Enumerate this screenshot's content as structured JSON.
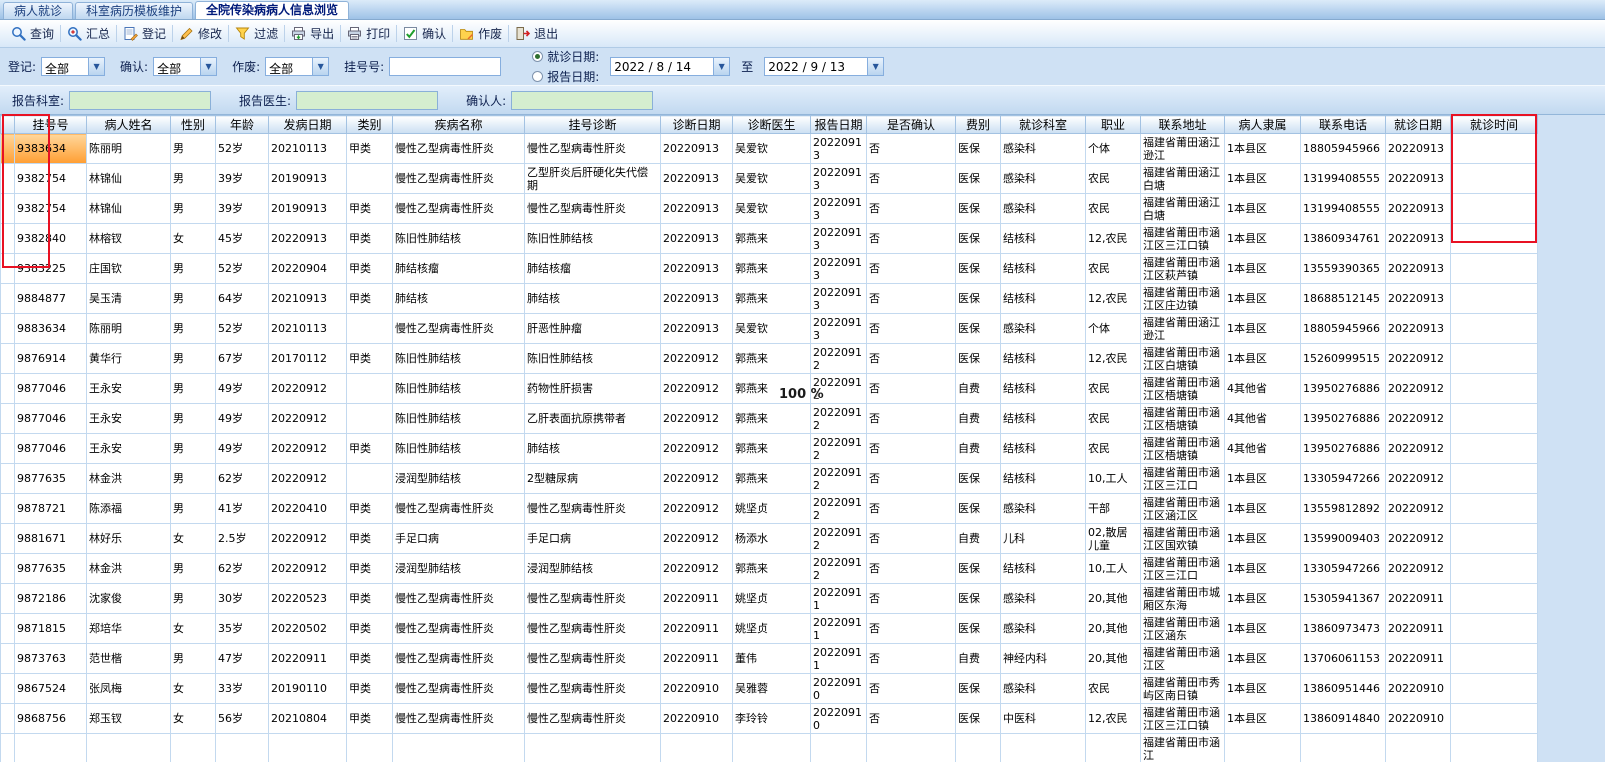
{
  "window": {
    "tabs": [
      {
        "label": "病人就诊",
        "active": false
      },
      {
        "label": "科室病历模板维护",
        "active": false
      },
      {
        "label": "全院传染病病人信息浏览",
        "active": true
      }
    ]
  },
  "toolbar": {
    "items": [
      {
        "label": "查询",
        "icon": "search-icon"
      },
      {
        "label": "汇总",
        "icon": "summary-icon"
      },
      {
        "label": "登记",
        "icon": "register-icon"
      },
      {
        "label": "修改",
        "icon": "modify-icon"
      },
      {
        "label": "过滤",
        "icon": "filter-icon"
      },
      {
        "label": "导出",
        "icon": "export-icon"
      },
      {
        "label": "打印",
        "icon": "print-icon"
      },
      {
        "label": "确认",
        "icon": "confirm-icon"
      },
      {
        "label": "作废",
        "icon": "void-icon"
      },
      {
        "label": "退出",
        "icon": "exit-icon"
      }
    ]
  },
  "filters": {
    "register_label": "登记:",
    "register_value": "全部",
    "confirm_label": "确认:",
    "confirm_value": "全部",
    "void_label": "作废:",
    "void_value": "全部",
    "regno_label": "挂号号:",
    "regno_value": "",
    "visit_date_label": "就诊日期:",
    "visit_date_selected": true,
    "report_date_label": "报告日期:",
    "report_date_selected": false,
    "date_from": "2022 / 8 / 14",
    "to_label": "至",
    "date_to": "2022 / 9 / 13",
    "report_dept_label": "报告科室:",
    "report_dept_value": "",
    "report_doctor_label": "报告医生:",
    "report_doctor_value": "",
    "confirmer_label": "确认人:",
    "confirmer_value": ""
  },
  "table": {
    "selected_row_index": 0,
    "columns": [
      "挂号号",
      "病人姓名",
      "性别",
      "年龄",
      "发病日期",
      "类别",
      "疾病名称",
      "挂号诊断",
      "诊断日期",
      "诊断医生",
      "报告日期",
      "是否确认",
      "费别",
      "就诊科室",
      "职业",
      "联系地址",
      "病人隶属",
      "联系电话",
      "就诊日期",
      "就诊时间"
    ],
    "rows": [
      [
        "9383634",
        "陈丽明",
        "男",
        "52岁",
        "20210113",
        "甲类",
        "慢性乙型病毒性肝炎",
        "慢性乙型病毒性肝炎",
        "20220913",
        "吴爱钦",
        "20220913",
        "否",
        "医保",
        "感染科",
        "个体",
        "福建省莆田涵江逊江",
        "1本县区",
        "18805945966",
        "20220913",
        ""
      ],
      [
        "9382754",
        "林锦仙",
        "男",
        "39岁",
        "20190913",
        "",
        "慢性乙型病毒性肝炎",
        "乙型肝炎后肝硬化失代偿期",
        "20220913",
        "吴爱钦",
        "20220913",
        "否",
        "医保",
        "感染科",
        "农民",
        "福建省莆田涵江白塘",
        "1本县区",
        "13199408555",
        "20220913",
        ""
      ],
      [
        "9382754",
        "林锦仙",
        "男",
        "39岁",
        "20190913",
        "甲类",
        "慢性乙型病毒性肝炎",
        "慢性乙型病毒性肝炎",
        "20220913",
        "吴爱钦",
        "20220913",
        "否",
        "医保",
        "感染科",
        "农民",
        "福建省莆田涵江白塘",
        "1本县区",
        "13199408555",
        "20220913",
        ""
      ],
      [
        "9382840",
        "林榕钗",
        "女",
        "45岁",
        "20220913",
        "甲类",
        "陈旧性肺结核",
        "陈旧性肺结核",
        "20220913",
        "郭燕来",
        "20220913",
        "否",
        "医保",
        "结核科",
        "12,农民",
        "福建省莆田市涵江区三江口镇",
        "1本县区",
        "13860934761",
        "20220913",
        ""
      ],
      [
        "9383225",
        "庄国钦",
        "男",
        "52岁",
        "20220904",
        "甲类",
        "肺结核瘤",
        "肺结核瘤",
        "20220913",
        "郭燕来",
        "20220913",
        "否",
        "医保",
        "结核科",
        "农民",
        "福建省莆田市涵江区萩芦镇",
        "1本县区",
        "13559390365",
        "20220913",
        ""
      ],
      [
        "9884877",
        "吴玉清",
        "男",
        "64岁",
        "20210913",
        "甲类",
        "肺结核",
        "肺结核",
        "20220913",
        "郭燕来",
        "20220913",
        "否",
        "医保",
        "结核科",
        "12,农民",
        "福建省莆田市涵江区庄边镇",
        "1本县区",
        "18688512145",
        "20220913",
        ""
      ],
      [
        "9883634",
        "陈丽明",
        "男",
        "52岁",
        "20210113",
        "",
        "慢性乙型病毒性肝炎",
        "肝恶性肿瘤",
        "20220913",
        "吴爱钦",
        "20220913",
        "否",
        "医保",
        "感染科",
        "个体",
        "福建省莆田涵江逊江",
        "1本县区",
        "18805945966",
        "20220913",
        ""
      ],
      [
        "9876914",
        "黄华行",
        "男",
        "67岁",
        "20170112",
        "甲类",
        "陈旧性肺结核",
        "陈旧性肺结核",
        "20220912",
        "郭燕来",
        "20220912",
        "否",
        "医保",
        "结核科",
        "12,农民",
        "福建省莆田市涵江区白塘镇",
        "1本县区",
        "15260999515",
        "20220912",
        ""
      ],
      [
        "9877046",
        "王永安",
        "男",
        "49岁",
        "20220912",
        "",
        "陈旧性肺结核",
        "药物性肝损害",
        "20220912",
        "郭燕来",
        "20220912",
        "否",
        "自费",
        "结核科",
        "农民",
        "福建省莆田市涵江区梧塘镇",
        "4其他省",
        "13950276886",
        "20220912",
        ""
      ],
      [
        "9877046",
        "王永安",
        "男",
        "49岁",
        "20220912",
        "",
        "陈旧性肺结核",
        "乙肝表面抗原携带者",
        "20220912",
        "郭燕来",
        "20220912",
        "否",
        "自费",
        "结核科",
        "农民",
        "福建省莆田市涵江区梧塘镇",
        "4其他省",
        "13950276886",
        "20220912",
        ""
      ],
      [
        "9877046",
        "王永安",
        "男",
        "49岁",
        "20220912",
        "甲类",
        "陈旧性肺结核",
        "肺结核",
        "20220912",
        "郭燕来",
        "20220912",
        "否",
        "自费",
        "结核科",
        "农民",
        "福建省莆田市涵江区梧塘镇",
        "4其他省",
        "13950276886",
        "20220912",
        ""
      ],
      [
        "9877635",
        "林金洪",
        "男",
        "62岁",
        "20220912",
        "",
        "浸润型肺结核",
        "2型糖尿病",
        "20220912",
        "郭燕来",
        "20220912",
        "否",
        "医保",
        "结核科",
        "10,工人",
        "福建省莆田市涵江区三江口",
        "1本县区",
        "13305947266",
        "20220912",
        ""
      ],
      [
        "9878721",
        "陈添福",
        "男",
        "41岁",
        "20220410",
        "甲类",
        "慢性乙型病毒性肝炎",
        "慢性乙型病毒性肝炎",
        "20220912",
        "姚坚贞",
        "20220912",
        "否",
        "医保",
        "感染科",
        "干部",
        "福建省莆田市涵江区涵江区",
        "1本县区",
        "13559812892",
        "20220912",
        ""
      ],
      [
        "9881671",
        "林好乐",
        "女",
        "2.5岁",
        "20220912",
        "甲类",
        "手足口病",
        "手足口病",
        "20220912",
        "杨添水",
        "20220912",
        "否",
        "自费",
        "儿科",
        "02,散居儿童",
        "福建省莆田市涵江区国欢镇",
        "1本县区",
        "13599009403",
        "20220912",
        ""
      ],
      [
        "9877635",
        "林金洪",
        "男",
        "62岁",
        "20220912",
        "甲类",
        "浸润型肺结核",
        "浸润型肺结核",
        "20220912",
        "郭燕来",
        "20220912",
        "否",
        "医保",
        "结核科",
        "10,工人",
        "福建省莆田市涵江区三江口",
        "1本县区",
        "13305947266",
        "20220912",
        ""
      ],
      [
        "9872186",
        "沈家俊",
        "男",
        "30岁",
        "20220523",
        "甲类",
        "慢性乙型病毒性肝炎",
        "慢性乙型病毒性肝炎",
        "20220911",
        "姚坚贞",
        "20220911",
        "否",
        "医保",
        "感染科",
        "20,其他",
        "福建省莆田市城厢区东海",
        "1本县区",
        "15305941367",
        "20220911",
        ""
      ],
      [
        "9871815",
        "郑培华",
        "女",
        "35岁",
        "20220502",
        "甲类",
        "慢性乙型病毒性肝炎",
        "慢性乙型病毒性肝炎",
        "20220911",
        "姚坚贞",
        "20220911",
        "否",
        "医保",
        "感染科",
        "20,其他",
        "福建省莆田市涵江区涵东",
        "1本县区",
        "13860973473",
        "20220911",
        ""
      ],
      [
        "9873763",
        "范世楷",
        "男",
        "47岁",
        "20220911",
        "甲类",
        "慢性乙型病毒性肝炎",
        "慢性乙型病毒性肝炎",
        "20220911",
        "董伟",
        "20220911",
        "否",
        "自费",
        "神经内科",
        "20,其他",
        "福建省莆田市涵江区",
        "1本县区",
        "13706061153",
        "20220911",
        ""
      ],
      [
        "9867524",
        "张凤梅",
        "女",
        "33岁",
        "20190110",
        "甲类",
        "慢性乙型病毒性肝炎",
        "慢性乙型病毒性肝炎",
        "20220910",
        "吴雅蓉",
        "20220910",
        "否",
        "医保",
        "感染科",
        "农民",
        "福建省莆田市秀屿区南日镇",
        "1本县区",
        "13860951446",
        "20220910",
        ""
      ],
      [
        "9868756",
        "郑玉钗",
        "女",
        "56岁",
        "20210804",
        "甲类",
        "慢性乙型病毒性肝炎",
        "慢性乙型病毒性肝炎",
        "20220910",
        "李玲铃",
        "20220910",
        "否",
        "医保",
        "中医科",
        "12,农民",
        "福建省莆田市涵江区三江口镇",
        "1本县区",
        "13860914840",
        "20220910",
        ""
      ],
      [
        "",
        "",
        "",
        "",
        "",
        "",
        "",
        "",
        "",
        "",
        "",
        "",
        "",
        "",
        "",
        "福建省莆田市涵江",
        "",
        "",
        "",
        ""
      ]
    ]
  },
  "overlay": {
    "progress_text": "100 %"
  },
  "colors": {
    "selection_orange": "#ff9e33",
    "annotation_red": "#e81123",
    "grid_line_blue": "#c3d9ef"
  }
}
